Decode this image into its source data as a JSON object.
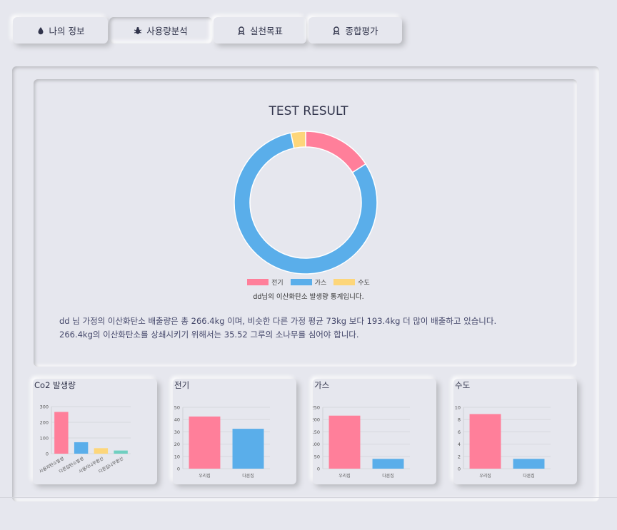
{
  "tabs": [
    {
      "label": "나의 정보",
      "icon": "droplet-icon",
      "active": false
    },
    {
      "label": "사용량분석",
      "icon": "bug-icon",
      "active": true
    },
    {
      "label": "실천목표",
      "icon": "award-icon",
      "active": false
    },
    {
      "label": "종합평가",
      "icon": "award-icon",
      "active": false
    }
  ],
  "result": {
    "title": "TEST RESULT",
    "legend": [
      "전기",
      "가스",
      "수도"
    ],
    "caption": "dd님의 이산화탄소 발생량 통계입니다.",
    "line1": "dd 님 가정의 이산화탄소 배출량은 총 266.4kg 이며, 비슷한 다른 가정 평균 73kg 보다 193.4kg 더 많이 배출하고 있습니다.",
    "line2": "266.4kg의 이산화탄소를 상쇄시키기 위해서는 35.52 그루의 소나무를 심어야 합니다."
  },
  "colors": {
    "electric": "#ff7f9a",
    "gas": "#5aaeea",
    "water": "#fdd67a",
    "teal": "#6fcfc0"
  },
  "chart_data": [
    {
      "type": "pie",
      "title": "TEST RESULT",
      "categories": [
        "전기",
        "가스",
        "수도"
      ],
      "values": [
        42.5,
        215.9,
        8.9
      ]
    },
    {
      "type": "bar",
      "title": "Co2 발생량",
      "categories": [
        "사용자탄소발생",
        "다른집탄소발생",
        "사용자나무환산",
        "다른집나무환산"
      ],
      "values": [
        266,
        73,
        35,
        20
      ],
      "ylim": [
        0,
        300
      ],
      "yticks": [
        0,
        100,
        200,
        300
      ]
    },
    {
      "type": "bar",
      "title": "전기",
      "categories": [
        "우리집",
        "다른집"
      ],
      "values": [
        42.5,
        32.5
      ],
      "ylim": [
        0,
        50
      ],
      "yticks": [
        0,
        10,
        20,
        30,
        40,
        50
      ]
    },
    {
      "type": "bar",
      "title": "가스",
      "categories": [
        "우리집",
        "다른집"
      ],
      "values": [
        216,
        40
      ],
      "ylim": [
        0,
        250
      ],
      "yticks": [
        0,
        50,
        100,
        150,
        200,
        250
      ]
    },
    {
      "type": "bar",
      "title": "수도",
      "categories": [
        "우리집",
        "다른집"
      ],
      "values": [
        8.9,
        1.6
      ],
      "ylim": [
        0,
        10
      ],
      "yticks": [
        0,
        2,
        4,
        6,
        8,
        10
      ]
    }
  ]
}
